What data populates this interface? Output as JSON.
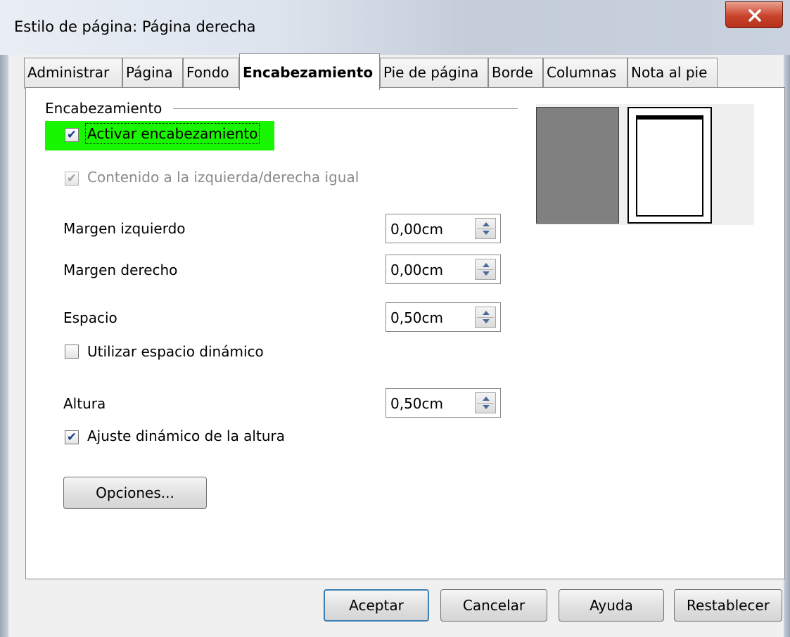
{
  "window": {
    "title": "Estilo de página: Página derecha"
  },
  "tabs": [
    {
      "label": "Administrar"
    },
    {
      "label": "Página"
    },
    {
      "label": "Fondo"
    },
    {
      "label": "Encabezamiento",
      "active": true
    },
    {
      "label": "Pie de página"
    },
    {
      "label": "Borde"
    },
    {
      "label": "Columnas"
    },
    {
      "label": "Nota al pie"
    }
  ],
  "header_group": {
    "title": "Encabezamiento",
    "activate": {
      "label": "Activar encabezamiento",
      "checked": true,
      "highlight_color": "#19f700"
    },
    "same_content": {
      "label": "Contenido a la izquierda/derecha igual",
      "checked": true,
      "enabled": false
    },
    "fields": {
      "left_margin": {
        "label": "Margen izquierdo",
        "value": "0,00cm"
      },
      "right_margin": {
        "label": "Margen derecho",
        "value": "0,00cm"
      },
      "spacing": {
        "label": "Espacio",
        "value": "0,50cm"
      },
      "height": {
        "label": "Altura",
        "value": "0,50cm"
      }
    },
    "dynamic_spacing": {
      "label": "Utilizar espacio dinámico",
      "checked": false
    },
    "autofit_height": {
      "label": "Ajuste dinámico de la altura",
      "checked": true
    },
    "options_button": "Opciones..."
  },
  "buttons": {
    "ok": "Aceptar",
    "cancel": "Cancelar",
    "help": "Ayuda",
    "reset": "Restablecer"
  },
  "colors": {
    "close_button": "#c9432c",
    "checkmark": "#1a3f8e",
    "default_button_border": "#3c7fb1"
  }
}
